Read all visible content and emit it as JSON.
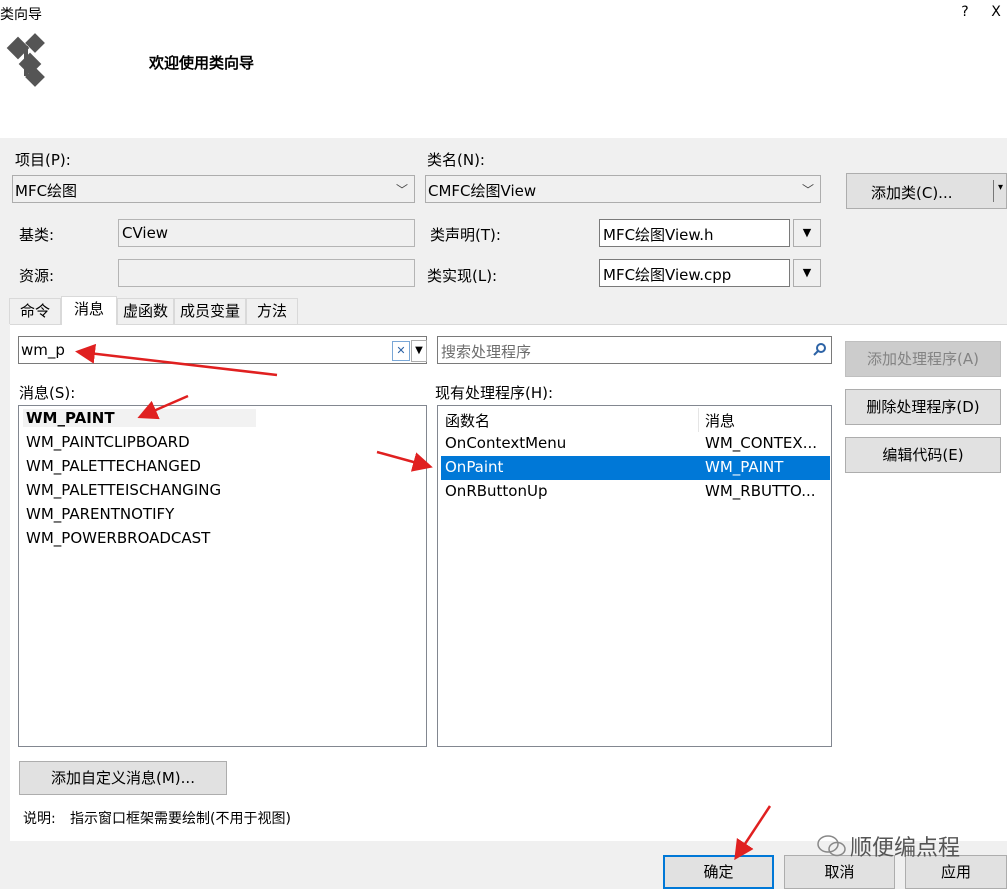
{
  "window": {
    "title": "类向导",
    "help_label": "?",
    "close_label": "X"
  },
  "header": {
    "welcome_text": "欢迎使用类向导",
    "logo_icon": "class-wizard-icon"
  },
  "project": {
    "label": "项目(P):",
    "value": "MFC绘图"
  },
  "classname": {
    "label": "类名(N):",
    "value": "CMFC绘图View"
  },
  "add_class_button": "添加类(C)...",
  "base_class": {
    "label": "基类:",
    "value": "CView"
  },
  "resource": {
    "label": "资源:",
    "value": ""
  },
  "class_declaration": {
    "label": "类声明(T):",
    "value": "MFC绘图View.h"
  },
  "class_implementation": {
    "label": "类实现(L):",
    "value": "MFC绘图View.cpp"
  },
  "tabs": [
    "命令",
    "消息",
    "虚函数",
    "成员变量",
    "方法"
  ],
  "active_tab": "消息",
  "filter": {
    "value": "wm_p"
  },
  "handler_search": {
    "placeholder": "搜索处理程序"
  },
  "messages": {
    "label": "消息(S):",
    "items": [
      "WM_PAINT",
      "WM_PAINTCLIPBOARD",
      "WM_PALETTECHANGED",
      "WM_PALETTEISCHANGING",
      "WM_PARENTNOTIFY",
      "WM_POWERBROADCAST"
    ],
    "selected": "WM_PAINT"
  },
  "existing_handlers": {
    "label": "现有处理程序(H):",
    "columns": [
      "函数名",
      "消息"
    ],
    "rows": [
      [
        "OnContextMenu",
        "WM_CONTEX..."
      ],
      [
        "OnPaint",
        "WM_PAINT"
      ],
      [
        "OnRButtonUp",
        "WM_RBUTTO..."
      ]
    ],
    "selected": "OnPaint"
  },
  "side_buttons": {
    "add_handler": "添加处理程序(A)",
    "delete_handler": "删除处理程序(D)",
    "edit_code": "编辑代码(E)"
  },
  "add_custom_message_button": "添加自定义消息(M)...",
  "description": {
    "label": "说明:",
    "text": "指示窗口框架需要绘制(不用于视图)"
  },
  "footer": {
    "ok": "确定",
    "cancel": "取消",
    "apply": "应用"
  },
  "watermark": "顺便编点程",
  "colors": {
    "selection": "#0078d7",
    "annotation_arrow": "#e02020"
  }
}
